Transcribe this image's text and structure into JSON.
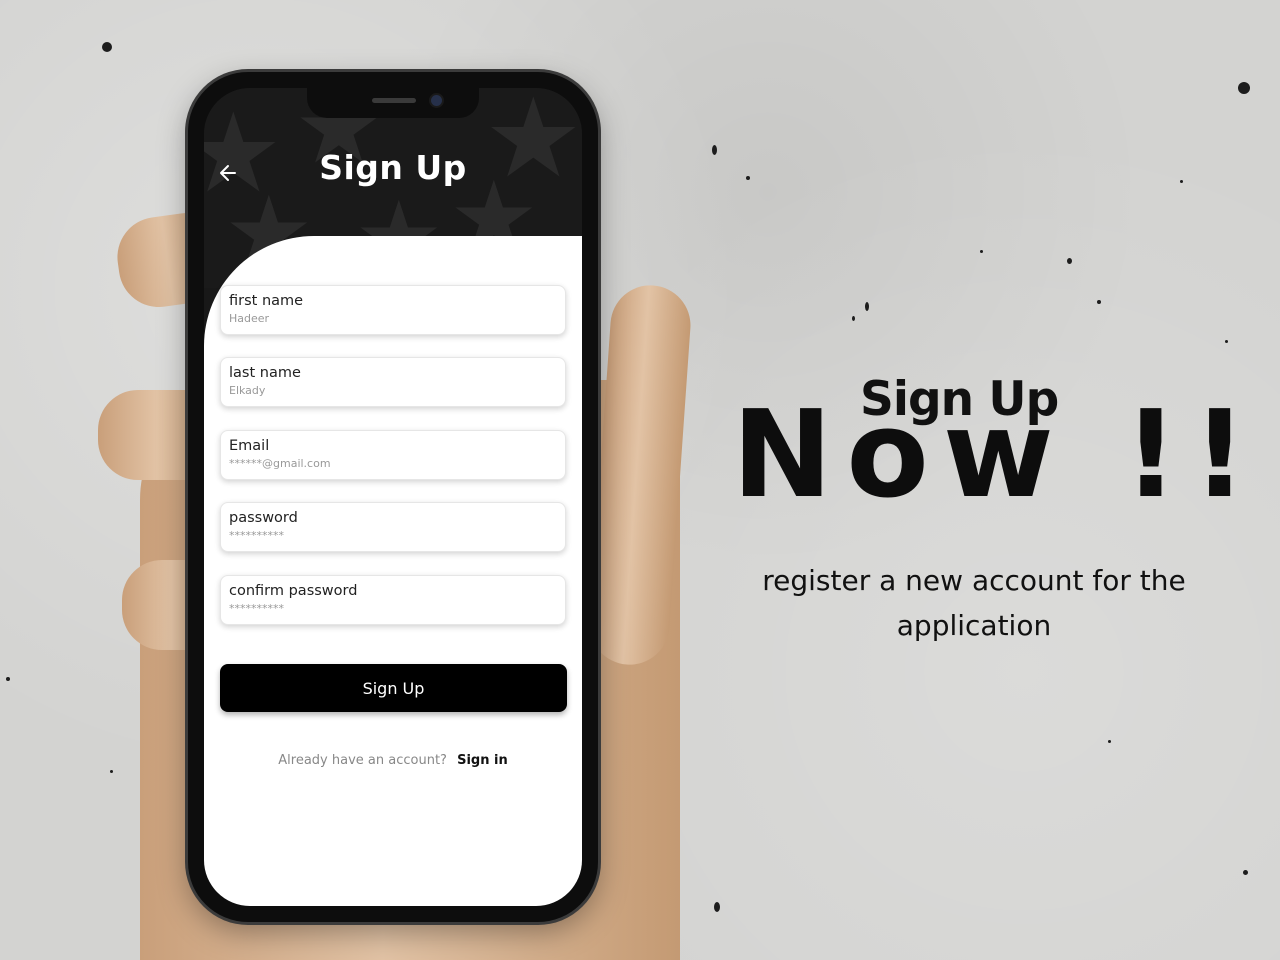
{
  "screen": {
    "title": "Sign Up",
    "back_icon": "arrow-left-icon",
    "fields": [
      {
        "label": "first name",
        "value": "Hadeer"
      },
      {
        "label": "last name",
        "value": "Elkady"
      },
      {
        "label": "Email",
        "value": "******@gmail.com"
      },
      {
        "label": "password",
        "value": "**********"
      },
      {
        "label": "confirm password",
        "value": "**********"
      }
    ],
    "submit_label": "Sign Up",
    "signin_prompt": "Already have an account?",
    "signin_link": "Sign in"
  },
  "promo": {
    "headline_small": "Sign Up",
    "headline_big": "Now !!",
    "description": "register a new account for the application"
  },
  "colors": {
    "background": "#d3d3d1",
    "phone_header": "#1a1a1a",
    "button": "#000000",
    "text_dark": "#111111"
  }
}
